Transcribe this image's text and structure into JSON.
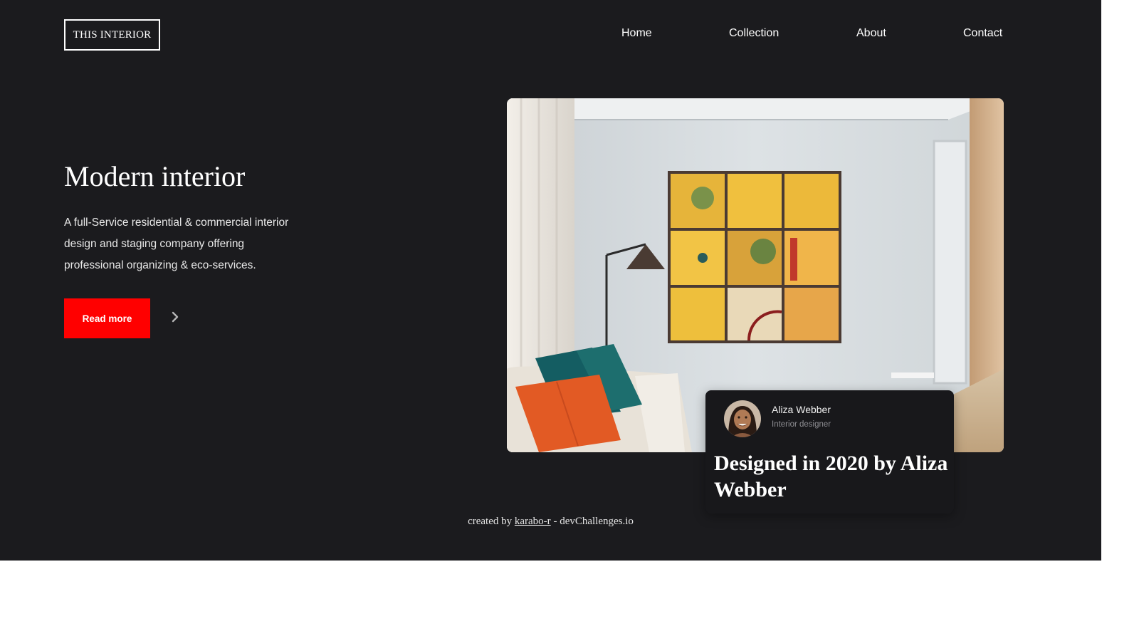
{
  "logo": {
    "text": "THIS INTERIOR"
  },
  "nav": {
    "items": [
      {
        "label": "Home"
      },
      {
        "label": "Collection"
      },
      {
        "label": "About"
      },
      {
        "label": "Contact"
      }
    ]
  },
  "hero": {
    "title": "Modern interior",
    "description": "A full-Service residential & commercial interior design and staging company offering professional organizing & eco-services.",
    "button_label": "Read more",
    "arrow_icon": "chevron-right-icon"
  },
  "feature_image": {
    "icon": "interior-photo"
  },
  "designer_card": {
    "name": "Aliza Webber",
    "role": "Interior designer",
    "headline": "Designed in 2020 by Aliza Webber"
  },
  "footer": {
    "prefix": "created by",
    "author_link": "karabo-r",
    "separator": "-",
    "site": "devChallenges.io"
  },
  "colors": {
    "background": "#1b1b1e",
    "accent": "#ff0000",
    "card": "#18181b",
    "text": "#ffffff"
  }
}
